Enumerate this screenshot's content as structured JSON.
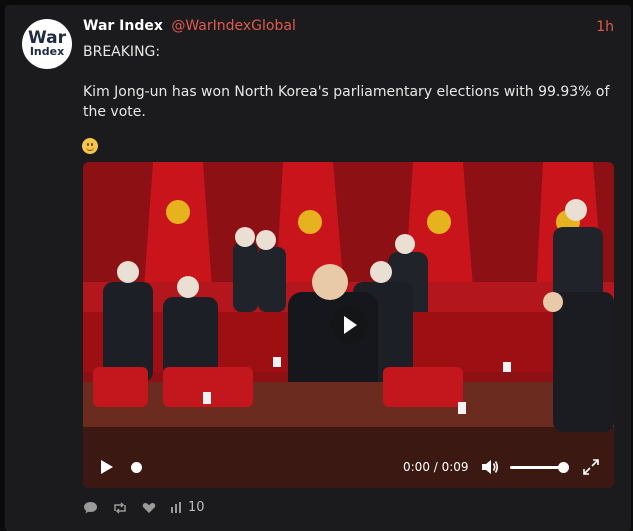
{
  "post": {
    "author_name": "War Index",
    "author_handle": "@WarIndexGlobal",
    "time": "1h",
    "avatar": {
      "line1": "War",
      "line2": "Index"
    },
    "text_line1": "BREAKING:",
    "text_line2": "Kim Jong-un has won North Korea's parliamentary elections with 99.93% of the vote.",
    "emoji": "slightly-smiling-face"
  },
  "video": {
    "time_display": "0:00 / 0:09",
    "progress": 0,
    "volume": 1.0,
    "icons": [
      "play-icon",
      "volume-icon",
      "fullscreen-icon"
    ]
  },
  "actions": {
    "icons": [
      "reply-icon",
      "repost-icon",
      "like-icon",
      "views-icon"
    ],
    "views_count": "10"
  },
  "colors": {
    "background": "#1b1b1d",
    "accent": "#e05a4e",
    "text": "#e7e7e7"
  }
}
